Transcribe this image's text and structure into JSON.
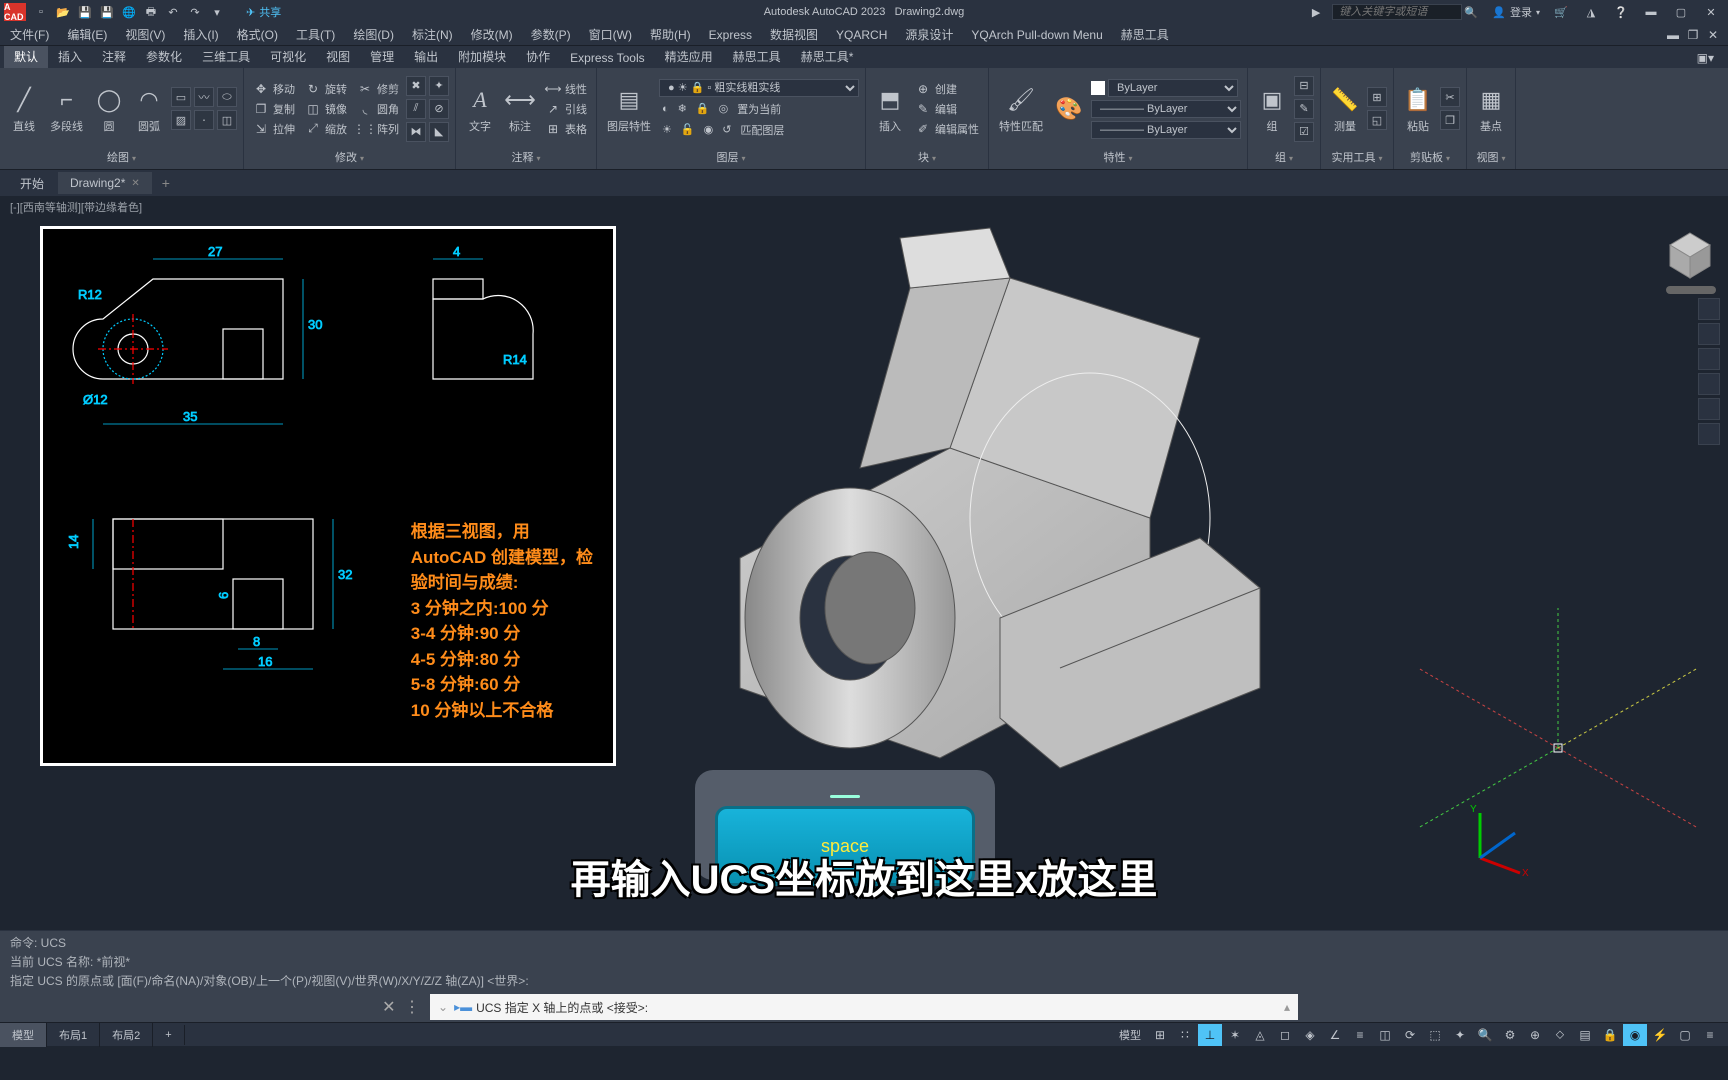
{
  "title": {
    "app": "Autodesk AutoCAD 2023",
    "file": "Drawing2.dwg"
  },
  "app_icon": "A CAD",
  "share": "共享",
  "search_placeholder": "键入关键字或短语",
  "login": "登录",
  "menu": [
    "文件(F)",
    "编辑(E)",
    "视图(V)",
    "插入(I)",
    "格式(O)",
    "工具(T)",
    "绘图(D)",
    "标注(N)",
    "修改(M)",
    "参数(P)",
    "窗口(W)",
    "帮助(H)",
    "Express",
    "数据视图",
    "YQARCH",
    "源泉设计",
    "YQArch Pull-down Menu",
    "赫思工具"
  ],
  "ribbon_tabs": [
    "默认",
    "插入",
    "注释",
    "参数化",
    "三维工具",
    "可视化",
    "视图",
    "管理",
    "输出",
    "附加模块",
    "协作",
    "Express Tools",
    "精选应用",
    "赫思工具",
    "赫思工具*"
  ],
  "panels": {
    "draw": {
      "label": "绘图",
      "line": "直线",
      "pline": "多段线",
      "circle": "圆",
      "arc": "圆弧"
    },
    "modify": {
      "label": "修改",
      "move": "移动",
      "rotate": "旋转",
      "trim": "修剪",
      "copy": "复制",
      "mirror": "镜像",
      "fillet": "圆角",
      "stretch": "拉伸",
      "scale": "缩放",
      "array": "阵列"
    },
    "annot": {
      "label": "注释",
      "text": "文字",
      "dim": "标注",
      "linear": "线性",
      "leader": "引线",
      "table": "表格"
    },
    "layer": {
      "label": "图层",
      "props": "图层特性",
      "current": "置为当前",
      "match": "匹配图层"
    },
    "block": {
      "label": "块",
      "insert": "插入",
      "create": "创建",
      "edit": "编辑",
      "battr": "编辑属性"
    },
    "props": {
      "label": "特性",
      "match": "特性匹配",
      "linetype": "粗实线",
      "bylayer1": "ByLayer",
      "bylayer2": "ByLayer",
      "bylayer3": "ByLayer"
    },
    "group": {
      "label": "组",
      "group": "组"
    },
    "util": {
      "label": "实用工具",
      "measure": "测量"
    },
    "clip": {
      "label": "剪贴板",
      "paste": "粘贴"
    },
    "view": {
      "label": "视图",
      "base": "基点"
    }
  },
  "doc_tabs": {
    "start": "开始",
    "active": "Drawing2*"
  },
  "viewport_label": "[-][西南等轴测][带边缘着色]",
  "ref_text": {
    "l1": "根据三视图，用",
    "l2": "AutoCAD 创建模型，检",
    "l3": "验时间与成绩:",
    "l4": "3 分钟之内:100 分",
    "l5": "3-4 分钟:90 分",
    "l6": "4-5 分钟:80 分",
    "l7": "5-8 分钟:60 分",
    "l8": "10 分钟以上不合格"
  },
  "dims": {
    "d27": "27",
    "d4": "4",
    "r12": "R12",
    "d30": "30",
    "phi12": "Ø12",
    "d35": "35",
    "r14": "R14",
    "d14": "14",
    "d32": "32",
    "d6": "6",
    "d8": "8",
    "d16": "16"
  },
  "space_key": "space",
  "subtitle": "再输入UCS坐标放到这里x放这里",
  "cmd_history": {
    "l1": "命令: UCS",
    "l2": "当前 UCS 名称: *前视*",
    "l3": "指定 UCS 的原点或 [面(F)/命名(NA)/对象(OB)/上一个(P)/视图(V)/世界(W)/X/Y/Z/Z 轴(ZA)] <世界>:"
  },
  "cmd_prompt": "UCS 指定 X 轴上的点或 <接受>:",
  "cmd_arrow": "▸▬",
  "layout_tabs": [
    "模型",
    "布局1",
    "布局2"
  ],
  "status_label": "模型"
}
